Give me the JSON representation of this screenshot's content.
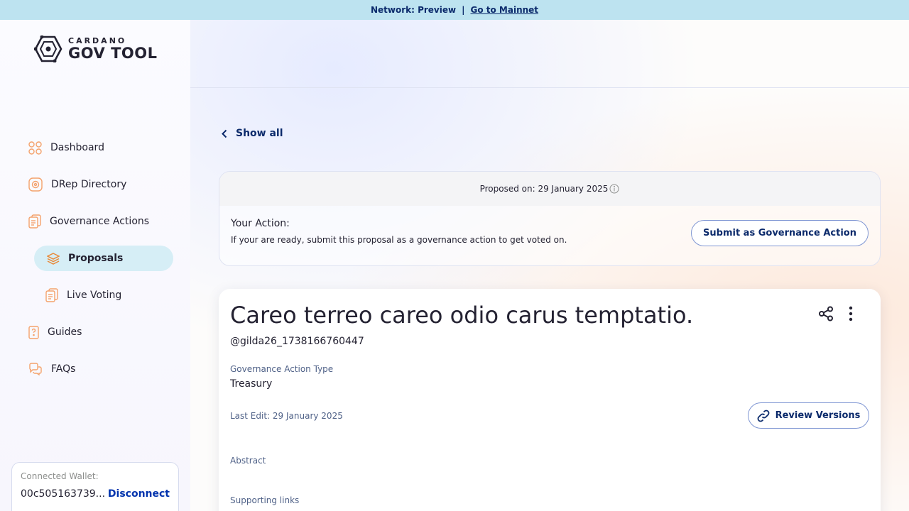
{
  "banner": {
    "network_text": "Network: Preview",
    "separator": "|",
    "mainnet_link": "Go to Mainnet"
  },
  "logo": {
    "small": "CARDANO",
    "big": "GOV TOOL"
  },
  "sidebar": {
    "items": [
      {
        "label": "Dashboard",
        "icon": "dashboard-icon"
      },
      {
        "label": "DRep Directory",
        "icon": "drep-directory-icon"
      },
      {
        "label": "Governance Actions",
        "icon": "governance-actions-icon"
      },
      {
        "label": "Proposals",
        "icon": "proposals-icon"
      },
      {
        "label": "Live Voting",
        "icon": "live-voting-icon"
      },
      {
        "label": "Guides",
        "icon": "guides-icon"
      },
      {
        "label": "FAQs",
        "icon": "faqs-icon"
      }
    ],
    "wallet": {
      "label": "Connected Wallet:",
      "address": "00c505163739...",
      "disconnect": "Disconnect"
    }
  },
  "main": {
    "back_label": "Show all",
    "action_card": {
      "proposed_on": "Proposed on: 29 January 2025",
      "your_action_title": "Your Action:",
      "your_action_desc": "If your are ready, submit this proposal as a governance action to get voted on.",
      "submit_button": "Submit as Governance Action"
    },
    "proposal": {
      "title": "Careo terreo careo odio carus temptatio.",
      "username": "@gilda26_1738166760447",
      "type_label": "Governance Action Type",
      "type_value": "Treasury",
      "last_edit": "Last Edit: 29 January 2025",
      "review_button": "Review Versions",
      "abstract_label": "Abstract",
      "supporting_links_label": "Supporting links"
    }
  },
  "colors": {
    "accent": "#0033ad",
    "banner_bg": "#bde3f0",
    "active_nav_bg": "#d6eef6",
    "icon_orange": "#f4a26b"
  }
}
